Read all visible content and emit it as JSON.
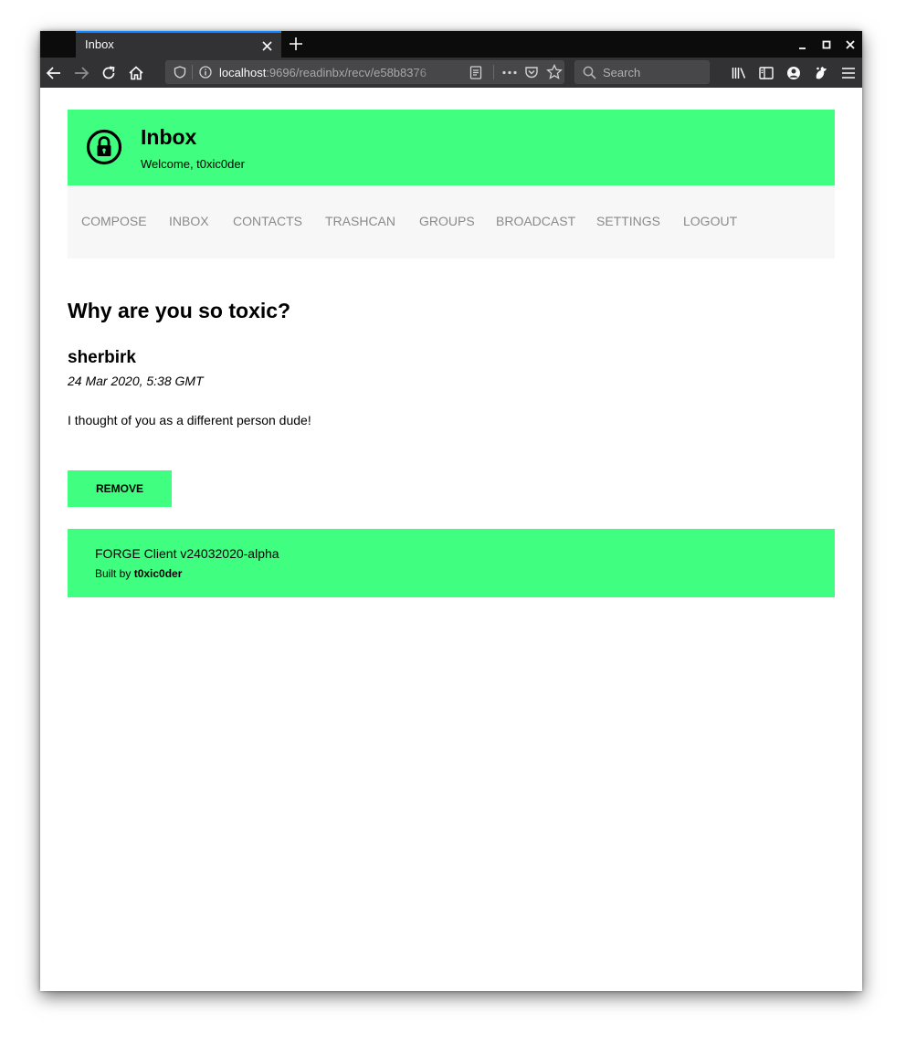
{
  "browser": {
    "tab_title": "Inbox",
    "url_host": "localhost",
    "url_rest": ":9696/readinbx/recv/e58b8376",
    "search_placeholder": "Search",
    "icons": {
      "back": "back-arrow-icon",
      "forward": "forward-arrow-icon",
      "reload": "reload-icon",
      "home": "home-icon",
      "shield": "tracking-shield-icon",
      "info": "site-info-icon",
      "reader": "reader-view-icon",
      "more": "page-actions-icon",
      "pocket": "pocket-icon",
      "bookmark": "bookmark-star-icon",
      "library": "library-icon",
      "sidebar": "sidebar-icon",
      "account": "account-icon",
      "extension": "extension-icon",
      "menu": "hamburger-menu-icon"
    }
  },
  "header": {
    "icon": "lock-icon",
    "title": "Inbox",
    "welcome": "Welcome, t0xic0der"
  },
  "menu": {
    "items": [
      "COMPOSE",
      "INBOX",
      "CONTACTS",
      "TRASHCAN",
      "GROUPS",
      "BROADCAST",
      "SETTINGS",
      "LOGOUT"
    ]
  },
  "message": {
    "subject": "Why are you so toxic?",
    "sender": "sherbirk",
    "date": "24 Mar 2020, 5:38 GMT",
    "body": "I thought of you as a different person dude!",
    "remove_label": "REMOVE"
  },
  "footer": {
    "client": "FORGE Client v24032020-alpha",
    "built_prefix": "Built by",
    "author": "t0xic0der"
  },
  "colors": {
    "accent": "#40ff80",
    "menu_background": "#f7f7f7",
    "menu_text": "#8a8a8a",
    "browser_chrome": "#323234",
    "tab_indicator": "#0a84ff"
  }
}
